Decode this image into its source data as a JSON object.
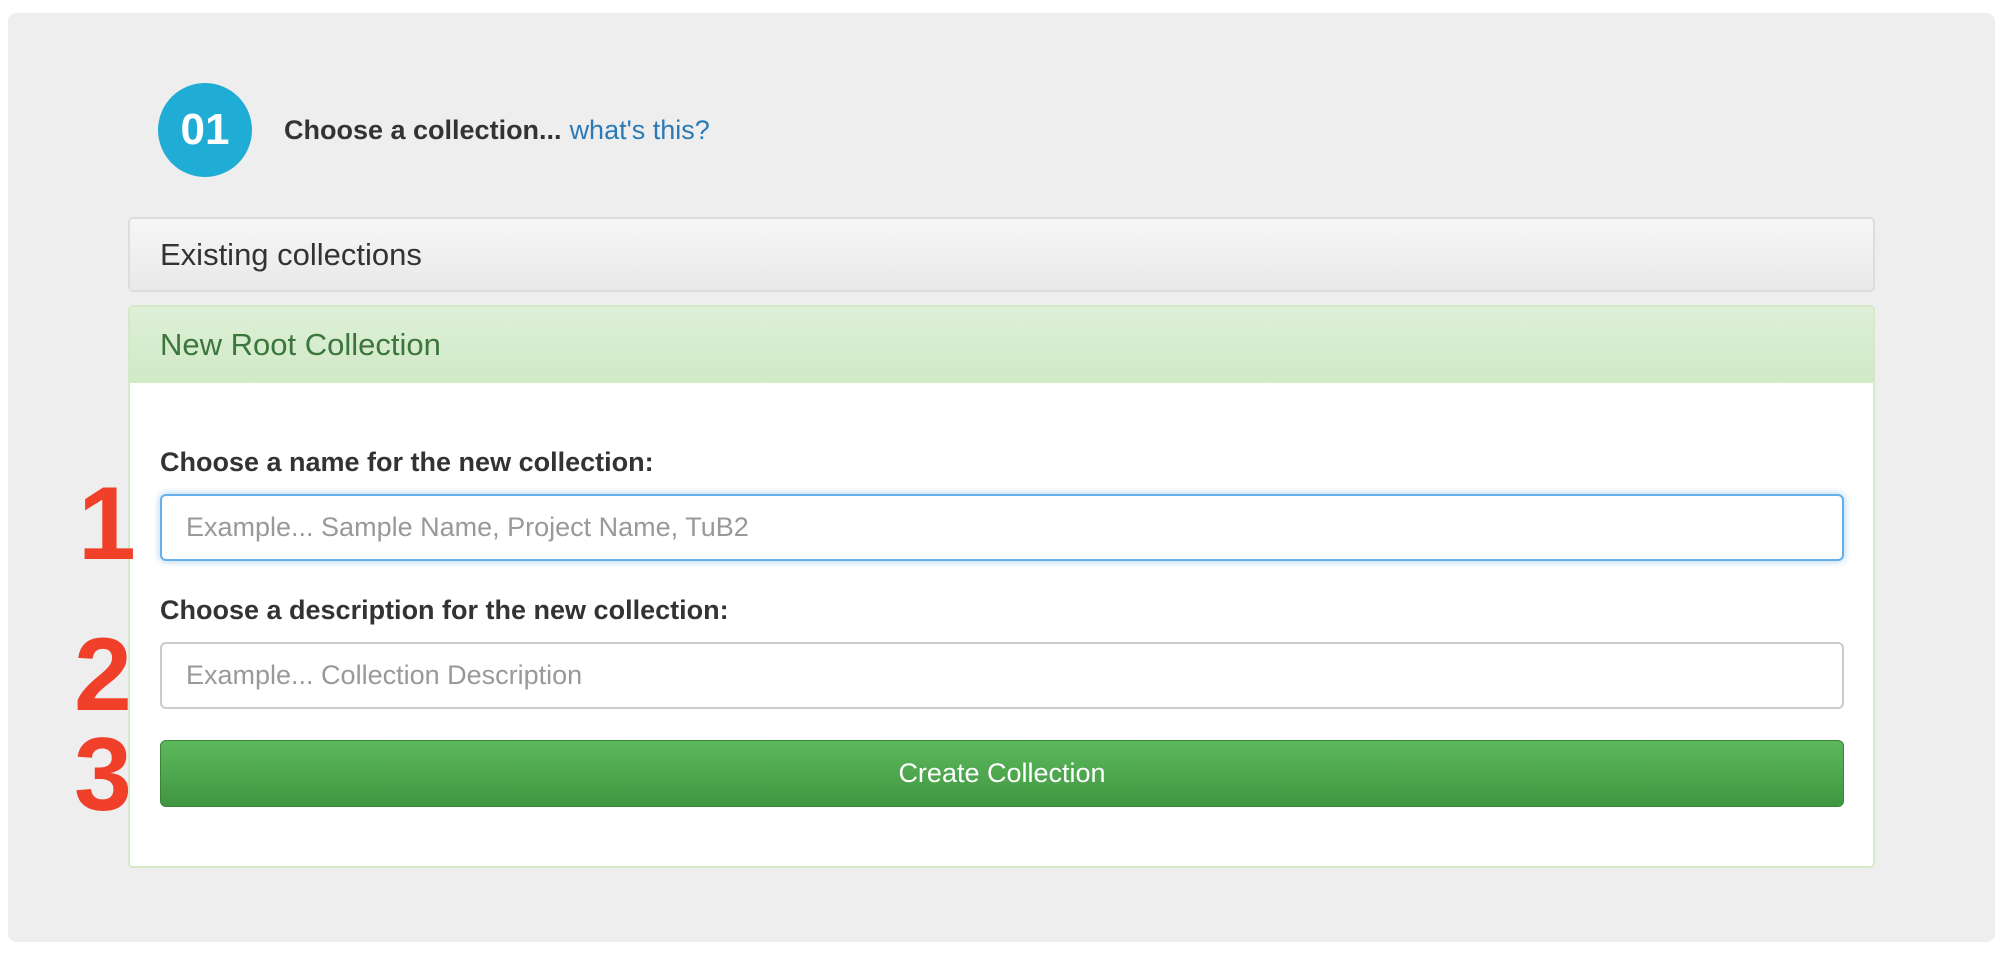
{
  "step": {
    "number": "01",
    "title": "Choose a collection...",
    "help_link": "what's this?"
  },
  "panels": {
    "existing_title": "Existing collections",
    "new_title": "New Root Collection"
  },
  "form": {
    "name_label": "Choose a name for the new collection:",
    "name_placeholder": "Example... Sample Name, Project Name, TuB2",
    "name_value": "",
    "description_label": "Choose a description for the new collection:",
    "description_placeholder": "Example... Collection Description",
    "description_value": "",
    "submit_label": "Create Collection"
  },
  "annotations": {
    "marker_1": "1",
    "marker_2": "2",
    "marker_3": "3"
  },
  "colors": {
    "step_circle": "#1fadd6",
    "link": "#2a7ab7",
    "new_panel_heading_text": "#3c763d",
    "create_button": "#4cae4c",
    "annotation_markers": "#f0402a"
  }
}
